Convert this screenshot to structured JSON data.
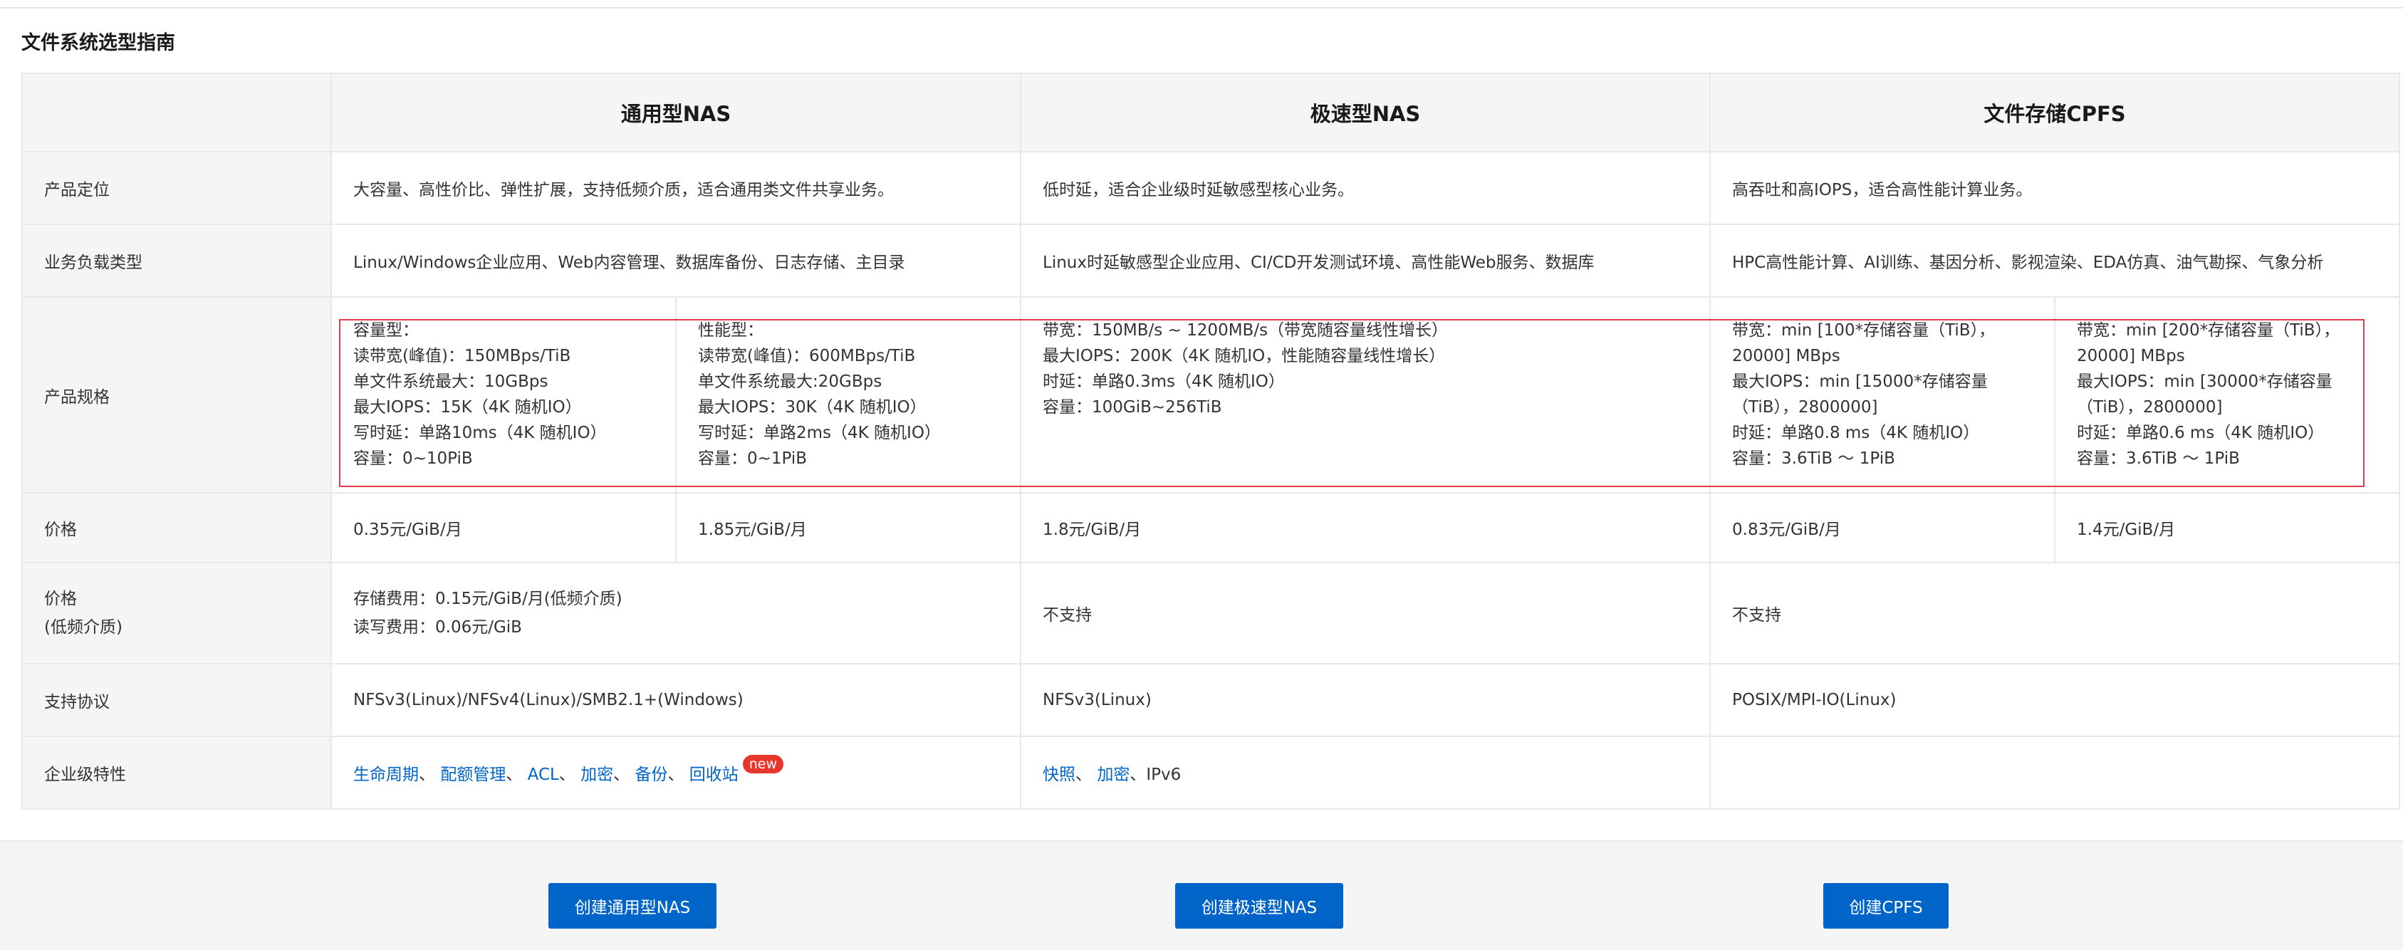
{
  "page": {
    "title": "文件系统选型指南"
  },
  "table": {
    "headers": [
      "通用型NAS",
      "极速型NAS",
      "文件存储CPFS"
    ],
    "rows": {
      "positioning": {
        "label": "产品定位",
        "general": "大容量、高性价比、弹性扩展，支持低频介质，适合通用类文件共享业务。",
        "extreme": "低时延，适合企业级时延敏感型核心业务。",
        "cpfs": "高吞吐和高IOPS，适合高性能计算业务。"
      },
      "workload": {
        "label": "业务负载类型",
        "general": "Linux/Windows企业应用、Web内容管理、数据库备份、日志存储、主目录",
        "extreme": "Linux时延敏感型企业应用、CI/CD开发测试环境、高性能Web服务、数据库",
        "cpfs": "HPC高性能计算、AI训练、基因分析、影视渲染、EDA仿真、油气勘探、气象分析"
      },
      "spec": {
        "label": "产品规格",
        "capacity_type": [
          "容量型：",
          "读带宽(峰值)：150MBps/TiB",
          "单文件系统最大：10GBps",
          "最大IOPS：15K（4K 随机IO）",
          "写时延：单路10ms（4K 随机IO）",
          "容量：0~10PiB"
        ],
        "performance_type": [
          "性能型：",
          "读带宽(峰值)：600MBps/TiB",
          "单文件系统最大:20GBps",
          "最大IOPS：30K（4K 随机IO）",
          "写时延：单路2ms（4K 随机IO）",
          "容量：0~1PiB"
        ],
        "extreme": [
          "带宽：150MB/s ~ 1200MB/s（带宽随容量线性增长）",
          "最大IOPS：200K（4K 随机IO，性能随容量线性增长）",
          "时延：单路0.3ms（4K 随机IO）",
          "容量：100GiB~256TiB"
        ],
        "cpfs_a": [
          "带宽：min [100*存储容量（TiB），",
          "20000] MBps",
          "最大IOPS：min [15000*存储容量",
          "（TiB），2800000]",
          "时延：单路0.8 ms（4K 随机IO）",
          "容量：3.6TiB ～ 1PiB"
        ],
        "cpfs_b": [
          "带宽：min [200*存储容量（TiB），",
          "20000] MBps",
          "最大IOPS：min [30000*存储容量",
          "（TiB），2800000]",
          "时延：单路0.6 ms（4K 随机IO）",
          "容量：3.6TiB ～ 1PiB"
        ]
      },
      "price": {
        "label": "价格",
        "capacity": "0.35元/GiB/月",
        "performance": "1.85元/GiB/月",
        "extreme": "1.8元/GiB/月",
        "cpfs_a": "0.83元/GiB/月",
        "cpfs_b": "1.4元/GiB/月"
      },
      "price_cold": {
        "label_line1": "价格",
        "label_line2": "(低频介质)",
        "general_line1": "存储费用：0.15元/GiB/月(低频介质)",
        "general_line2": "读写费用：0.06元/GiB",
        "extreme": "不支持",
        "cpfs": "不支持"
      },
      "protocol": {
        "label": "支持协议",
        "general": "NFSv3(Linux)/NFSv4(Linux)/SMB2.1+(Windows)",
        "extreme": "NFSv3(Linux)",
        "cpfs": "POSIX/MPI-IO(Linux)"
      },
      "features": {
        "label": "企业级特性",
        "general_links": [
          "生命周期",
          "配额管理",
          "ACL",
          "加密",
          "备份",
          "回收站"
        ],
        "separator": "、",
        "new_badge": "new",
        "extreme_links": [
          "快照",
          "加密"
        ],
        "extreme_plain": "IPv6"
      }
    }
  },
  "footer": {
    "buttons": [
      "创建通用型NAS",
      "创建极速型NAS",
      "创建CPFS"
    ]
  },
  "colors": {
    "link": "#0064c8",
    "button": "#0064c8",
    "highlight_border": "#e23a4a",
    "badge": "#e8362d"
  }
}
